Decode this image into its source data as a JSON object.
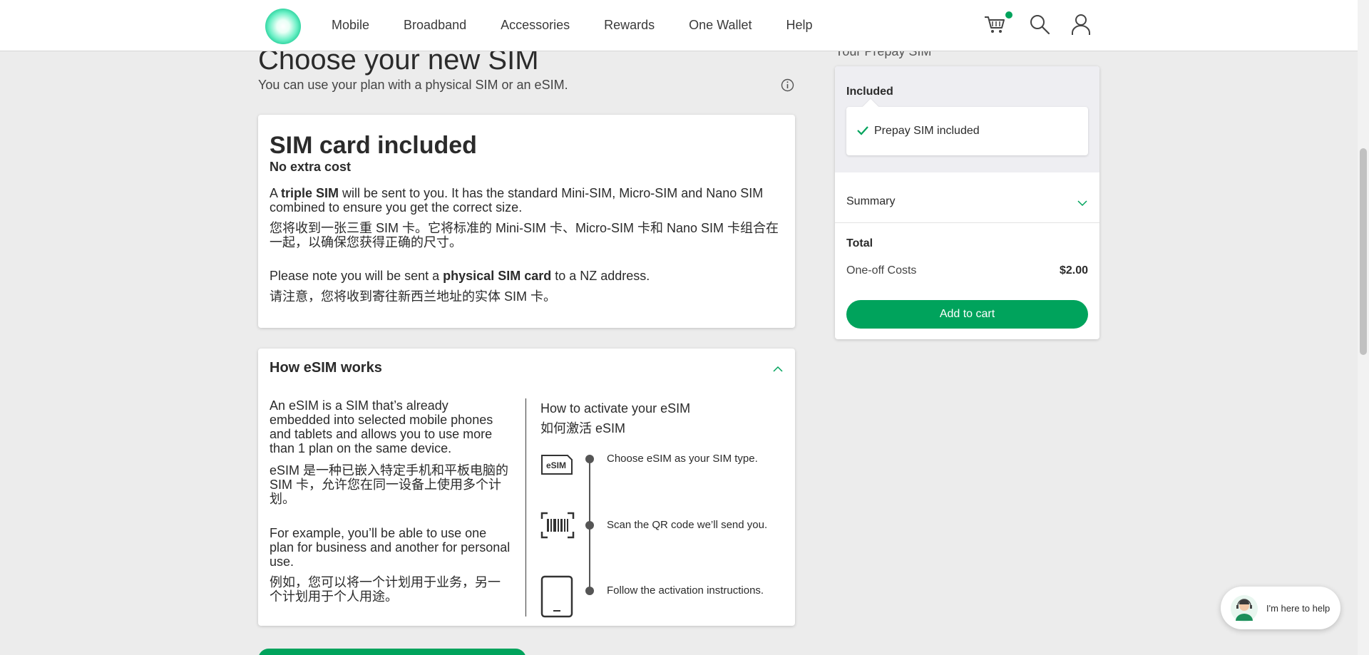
{
  "header": {
    "nav": [
      "Mobile",
      "Broadband",
      "Accessories",
      "Rewards",
      "One Wallet",
      "Help"
    ],
    "icons": [
      "cart-icon",
      "search-icon",
      "user-icon"
    ],
    "brand_color": "#00a35c"
  },
  "page": {
    "title": "Choose your new SIM",
    "subtitle": "You can use your plan with a physical SIM or an eSIM."
  },
  "sim_card": {
    "heading": "SIM card included",
    "sub": "No extra cost",
    "p1_a": "A ",
    "p1_bold": "triple SIM",
    "p1_b": " will be sent to you. It has the standard Mini-SIM, Micro-SIM and Nano SIM combined to ensure you get the correct size.",
    "p1_zh": "您将收到一张三重 SIM 卡。它将标准的 Mini-SIM 卡、Micro-SIM 卡和 Nano SIM 卡组合在一起，以确保您获得正确的尺寸。",
    "p2_a": "Please note you will be sent a ",
    "p2_bold": "physical SIM card",
    "p2_b": " to a NZ address.",
    "p2_zh": "请注意，您将收到寄往新西兰地址的实体 SIM 卡。"
  },
  "esim_card": {
    "heading": "How eSIM works",
    "left_p1": "An eSIM is a SIM that’s already embedded into selected mobile phones and tablets and allows you to use more than 1 plan on the same device.",
    "left_p1_zh": "eSIM 是一种已嵌入特定手机和平板电脑的 SIM 卡，允许您在同一设备上使用多个计划。",
    "left_p2": "For example, you’ll be able to use one plan for business and another for personal use.",
    "left_p2_zh": "例如，您可以将一个计划用于业务，另一个计划用于个人用途。",
    "how_title": "How to activate your eSIM",
    "how_title_zh": "如何激活 eSIM",
    "esim_chip_label": "eSIM",
    "steps": [
      {
        "text": "Choose eSIM as your SIM type.",
        "icon": "esim-chip-icon"
      },
      {
        "text": "Scan the QR code we’ll send you.",
        "icon": "qr-scan-icon"
      },
      {
        "text": "Follow the activation instructions.",
        "icon": "phone-icon"
      }
    ]
  },
  "summary": {
    "title": "Your Prepay SIM",
    "included_label": "Included",
    "included_item": "Prepay SIM included",
    "summary_label": "Summary",
    "total_label": "Total",
    "cost_label": "One-off Costs",
    "cost_value": "$2.00",
    "add_to_cart": "Add to cart"
  },
  "help": {
    "text": "I'm here to help"
  }
}
